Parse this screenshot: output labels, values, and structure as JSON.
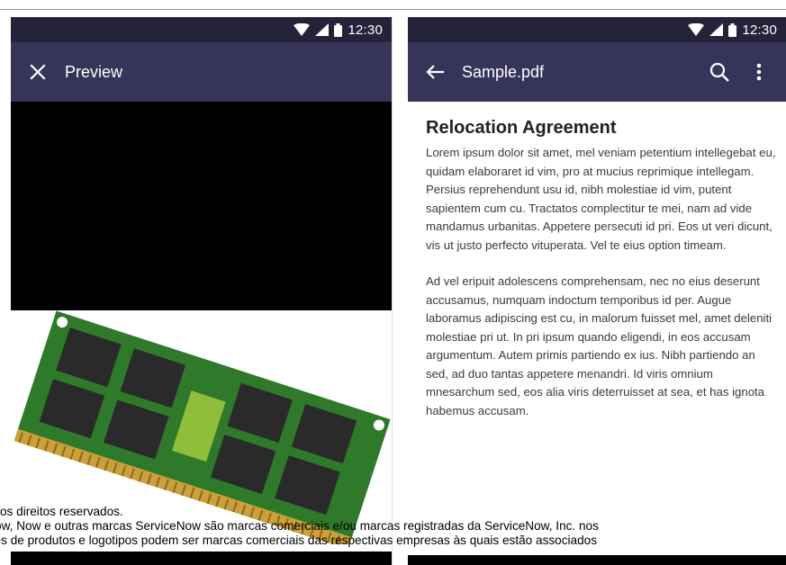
{
  "status": {
    "time": "12:30"
  },
  "left": {
    "appbar": {
      "title": "Preview",
      "close_icon": "close-icon"
    },
    "image": {
      "subject": "ram-memory-module"
    }
  },
  "right": {
    "appbar": {
      "title": "Sample.pdf",
      "back_icon": "arrow-left-icon",
      "search_icon": "search-icon",
      "more_icon": "more-vert-icon"
    },
    "document": {
      "heading": "Relocation Agreement",
      "paragraphs": [
        "Lorem ipsum dolor sit amet, mel veniam petentium intellegebat eu, quidam elaboraret id vim, pro at mucius reprimique intellegam. Persius reprehendunt usu id, nibh molestiae id vim, putent sapientem cum cu. Tractatos complectitur te mei, nam ad vide mandamus urbanitas. Appetere persecuti id pri. Eos ut veri dicunt, vis ut justo perfecto vituperata. Vel te eius option timeam.",
        "Ad vel eripuit adolescens comprehensam, nec no eius deserunt accusamus, numquam indoctum temporibus id per. Augue laboramus adipiscing est cu, in malorum fuisset mel, amet deleniti molestiae pri ut. In pri ipsum quando eligendi, in eos accusam argumentum. Autem primis partiendo ex ius. Nibh partiendo an sed, ad duo tantas appetere menandri. Id viris omnium mnesarchum sed, eos alia viris deterruisset at sea, et has ignota habemus accusam."
      ]
    }
  },
  "footer": {
    "line1": "os direitos reservados.",
    "line2": "low, Now e outras marcas ServiceNow são marcas comerciais e/ou marcas registradas da ServiceNow, Inc. nos",
    "line3": "nes de produtos e logotipos podem ser marcas comerciais das respectivas empresas às quais estão associados"
  },
  "colors": {
    "statusbar": "#25233a",
    "appbar": "#37345a"
  }
}
